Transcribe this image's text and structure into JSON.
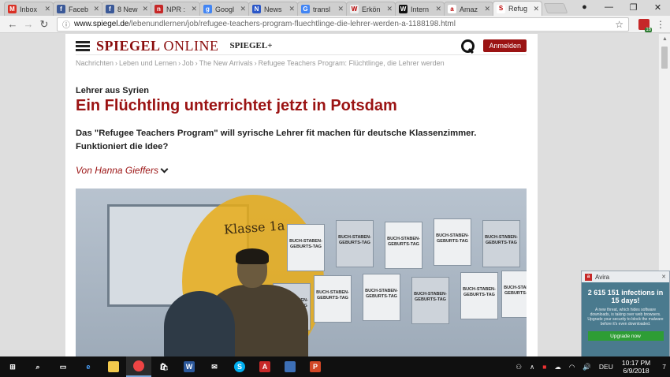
{
  "browser": {
    "tabs": [
      {
        "label": "Inbox",
        "icon": "gmail-icon",
        "color": "#d93025",
        "glyph": "M"
      },
      {
        "label": "Faceb",
        "icon": "facebook-icon",
        "color": "#3b5998",
        "glyph": "f"
      },
      {
        "label": "8 New",
        "icon": "facebook-icon",
        "color": "#3b5998",
        "glyph": "f"
      },
      {
        "label": "NPR :",
        "icon": "npr-icon",
        "color": "#c62828",
        "glyph": "n"
      },
      {
        "label": "Googl",
        "icon": "google-docs-icon",
        "color": "#4285f4",
        "glyph": "g"
      },
      {
        "label": "News",
        "icon": "news-icon",
        "color": "#2b57c8",
        "glyph": "N"
      },
      {
        "label": "transl",
        "icon": "google-icon",
        "color": "#4285f4",
        "glyph": "G"
      },
      {
        "label": "Erkön",
        "icon": "wikipedia-icon",
        "color": "#eeeeee",
        "glyph": "W"
      },
      {
        "label": "Intern",
        "icon": "wikipedia-icon",
        "color": "#111111",
        "glyph": "W"
      },
      {
        "label": "Amaz",
        "icon": "amazon-icon",
        "color": "#ffffff",
        "glyph": "a"
      },
      {
        "label": "Refug",
        "icon": "spiegel-icon",
        "color": "#ffffff",
        "glyph": "S",
        "active": true
      }
    ],
    "url_domain": "www.spiegel.de",
    "url_path": "/lebenundlernen/job/refugee-teachers-program-fluechtlinge-die-lehrer-werden-a-1188198.html",
    "extension_badge": "16"
  },
  "site": {
    "logo_main": "SPIEGEL",
    "logo_online": "ONLINE",
    "plus_label": "SPIEGEL+",
    "login_label": "Anmelden",
    "brand_color": "#9b1313"
  },
  "article": {
    "breadcrumb": [
      "Nachrichten",
      "Leben und Lernen",
      "Job",
      "The New Arrivals",
      "Refugee Teachers Program: Flüchtlinge, die Lehrer werden"
    ],
    "kicker": "Lehrer aus Syrien",
    "headline": "Ein Flüchtling unterrichtet jetzt in Potsdam",
    "teaser": "Das \"Refugee Teachers Program\" will syrische Lehrer fit machen für deutsche Klassenzimmer. Funktioniert die Idee?",
    "byline": "Von Hanna Gieffers",
    "image_sign": "Klasse 1a",
    "poster_text": "BUCH-STABEN-GEBURTS-TAG"
  },
  "avira": {
    "app": "Avira",
    "title": "2 615 151 infections in 15 days!",
    "text": "A new threat, which hides software downloads, is taking over web browsers. Upgrade your security to block the malware before it's even downloaded.",
    "button": "Upgrade now"
  },
  "taskbar": {
    "language": "DEU",
    "time": "10:17 PM",
    "date": "6/9/2018",
    "notifications": "7"
  }
}
